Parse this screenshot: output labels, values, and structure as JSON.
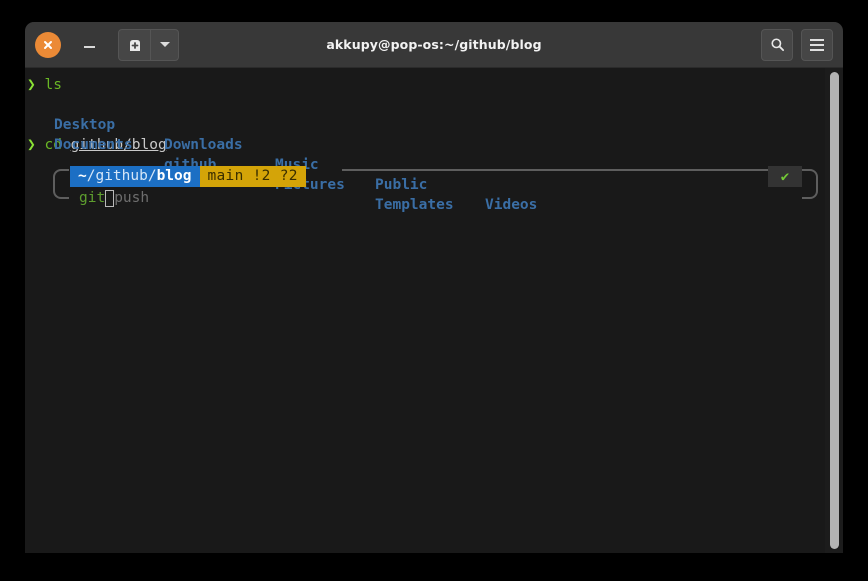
{
  "window": {
    "title": "akkupy@pop-os:~/github/blog",
    "titlebar": {
      "close_label": "close-window",
      "minimize_label": "minimize-window",
      "new_tab_label": "new-tab",
      "new_tab_dropdown_label": "new-tab-options",
      "search_label": "search",
      "menu_label": "main-menu"
    },
    "colors": {
      "titlebar_bg": "#383838",
      "terminal_bg": "#191919",
      "close_button": "#eb8a36",
      "prompt_path_bg": "#1c6fc4",
      "prompt_git_bg": "#d4a408",
      "success_tick": "#73c936",
      "dir_color": "#3a6ea5",
      "command_color": "#5e9e2e",
      "suggestion_color": "#6e6e6e",
      "frame_color": "#5e5e5e",
      "scrollbar_thumb": "#b3b3b3"
    }
  },
  "terminal": {
    "history": [
      {
        "type": "command",
        "arrow": "❯",
        "command": "ls"
      },
      {
        "type": "ls-output",
        "rows": [
          [
            "Desktop",
            "Downloads",
            "Music",
            "Public",
            "Videos"
          ],
          [
            "Documents",
            "github",
            "Pictures",
            "Templates",
            ""
          ]
        ],
        "column_x": [
          27,
          137,
          248,
          348,
          458
        ]
      },
      {
        "type": "command",
        "arrow": "❯",
        "command": "cd ",
        "argument": "github/blog"
      }
    ],
    "prompt": {
      "path_segment": {
        "tilde": "~",
        "middle": "/github/",
        "leaf": "blog"
      },
      "git_segment": "main !2 ?2",
      "status_icon": "✔",
      "status_name": "success-checkmark"
    },
    "input": {
      "typed": "git",
      "cursor": " ",
      "suggestion": "push"
    }
  }
}
